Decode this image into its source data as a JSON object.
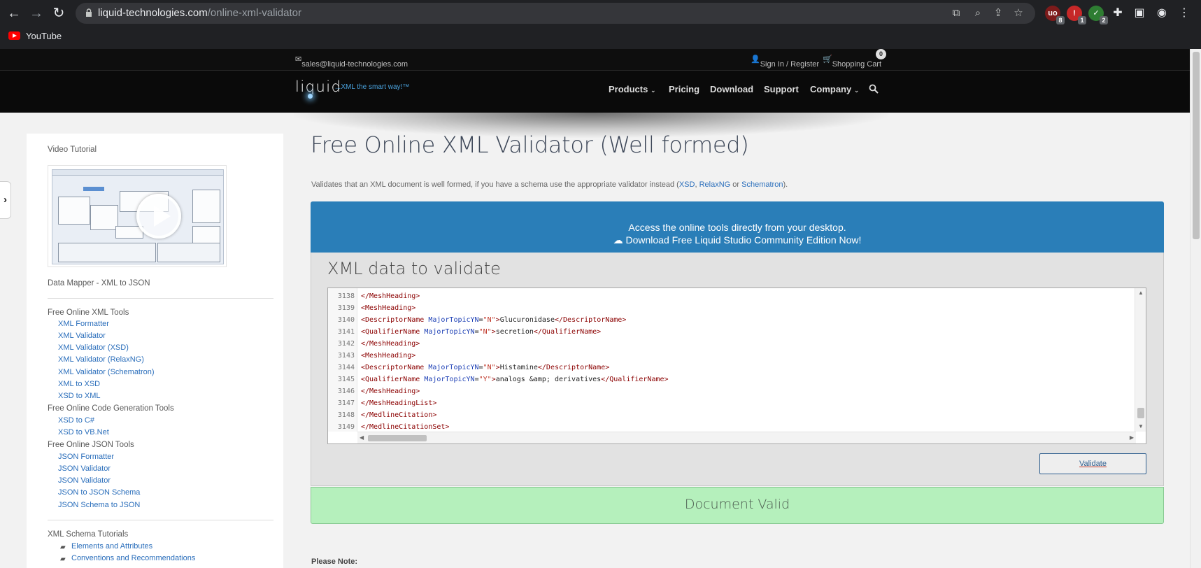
{
  "browser": {
    "url_domain": "liquid-technologies.com",
    "url_path": "/online-xml-validator",
    "bookmark": "YouTube",
    "extensions": [
      {
        "name": "ublock",
        "glyph": "uo",
        "badge": "8",
        "color": "#7d1b1b"
      },
      {
        "name": "ext-red",
        "glyph": "!",
        "badge": "1",
        "color": "#c62828"
      },
      {
        "name": "ext-green",
        "glyph": "✓",
        "badge": "2",
        "color": "#2e7d32"
      }
    ]
  },
  "site": {
    "email": "sales@liquid-technologies.com",
    "sign_in": "Sign In / Register",
    "cart": "Shopping Cart",
    "cart_count": "0",
    "logo": "liquid",
    "tagline": "...XML the smart way!™",
    "menu": [
      "Products",
      "Pricing",
      "Download",
      "Support",
      "Company"
    ]
  },
  "sidebar": {
    "video_title": "Video Tutorial",
    "mapper_title": "Data Mapper - XML to JSON",
    "groups": [
      {
        "title": "Free Online XML Tools",
        "links": [
          "XML Formatter",
          "XML Validator",
          "XML Validator (XSD)",
          "XML Validator (RelaxNG)",
          "XML Validator (Schematron)",
          "XML to XSD",
          "XSD to XML"
        ]
      },
      {
        "title": "Free Online Code Generation Tools",
        "links": [
          "XSD to C#",
          "XSD to VB.Net"
        ]
      },
      {
        "title": "Free Online JSON Tools",
        "links": [
          "JSON Formatter",
          "JSON Validator",
          "JSON Validator",
          "JSON to JSON Schema",
          "JSON Schema to JSON"
        ]
      }
    ],
    "tutorials_title": "XML Schema Tutorials",
    "tutorials": [
      "Elements and Attributes",
      "Conventions and Recommendations"
    ]
  },
  "main": {
    "title": "Free Online XML Validator (Well formed)",
    "intro_pre": "Validates that an XML document is well formed, if you have a schema use the appropriate validator instead (",
    "intro_link1": "XSD",
    "intro_sep1": ", ",
    "intro_link2": "RelaxNG",
    "intro_sep2": " or ",
    "intro_link3": "Schematron",
    "intro_post": ").",
    "banner_line1": "Access the online tools directly from your desktop.",
    "banner_line2": "Download Free Liquid Studio Community Edition Now!",
    "panel_title": "XML data to validate",
    "validate_label": "Validate",
    "result": "Document Valid",
    "note": "Please Note:"
  },
  "editor": {
    "lines": [
      {
        "n": "3138",
        "parts": [
          [
            "tg",
            "</MeshHeading>"
          ]
        ]
      },
      {
        "n": "3139",
        "parts": [
          [
            "tg",
            "<MeshHeading>"
          ]
        ]
      },
      {
        "n": "3140",
        "parts": [
          [
            "tg",
            "<DescriptorName "
          ],
          [
            "at",
            "MajorTopicYN"
          ],
          [
            "tx",
            "="
          ],
          [
            "vl",
            "\"N\""
          ],
          [
            "tg",
            ">"
          ],
          [
            "tx",
            "Glucuronidase"
          ],
          [
            "tg",
            "</DescriptorName>"
          ]
        ]
      },
      {
        "n": "3141",
        "parts": [
          [
            "tg",
            "<QualifierName "
          ],
          [
            "at",
            "MajorTopicYN"
          ],
          [
            "tx",
            "="
          ],
          [
            "vl",
            "\"N\""
          ],
          [
            "tg",
            ">"
          ],
          [
            "tx",
            "secretion"
          ],
          [
            "tg",
            "</QualifierName>"
          ]
        ]
      },
      {
        "n": "3142",
        "parts": [
          [
            "tg",
            "</MeshHeading>"
          ]
        ]
      },
      {
        "n": "3143",
        "parts": [
          [
            "tg",
            "<MeshHeading>"
          ]
        ]
      },
      {
        "n": "3144",
        "parts": [
          [
            "tg",
            "<DescriptorName "
          ],
          [
            "at",
            "MajorTopicYN"
          ],
          [
            "tx",
            "="
          ],
          [
            "vl",
            "\"N\""
          ],
          [
            "tg",
            ">"
          ],
          [
            "tx",
            "Histamine"
          ],
          [
            "tg",
            "</DescriptorName>"
          ]
        ]
      },
      {
        "n": "3145",
        "parts": [
          [
            "tg",
            "<QualifierName "
          ],
          [
            "at",
            "MajorTopicYN"
          ],
          [
            "tx",
            "="
          ],
          [
            "vl",
            "\"Y\""
          ],
          [
            "tg",
            ">"
          ],
          [
            "tx",
            "analogs &amp; derivatives"
          ],
          [
            "tg",
            "</QualifierName>"
          ]
        ]
      },
      {
        "n": "3146",
        "parts": [
          [
            "tg",
            "</MeshHeading>"
          ]
        ]
      },
      {
        "n": "3147",
        "parts": [
          [
            "tg",
            "</MeshHeadingList>"
          ]
        ]
      },
      {
        "n": "3148",
        "parts": [
          [
            "tg",
            "</MedlineCitation>"
          ]
        ]
      },
      {
        "n": "3149",
        "parts": [
          [
            "tg",
            "</MedlineCitationSet>"
          ]
        ]
      }
    ]
  },
  "colors": {
    "banner": "#2a7eb8",
    "result_bg": "#b5f0bc",
    "link": "#2a6ebb"
  }
}
